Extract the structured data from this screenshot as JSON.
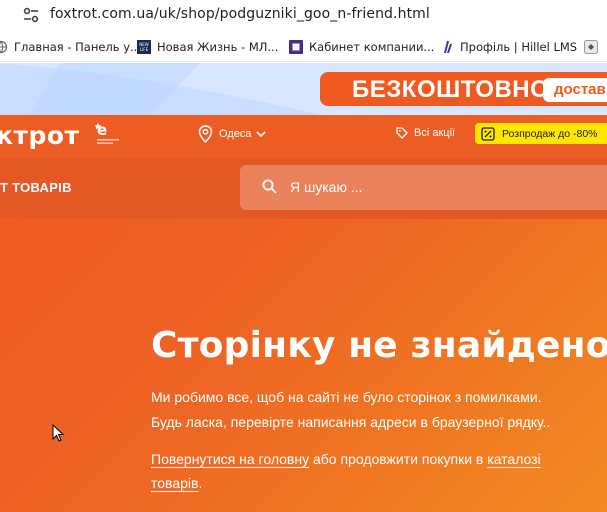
{
  "browser": {
    "url": "foxtrot.com.ua/uk/shop/podguzniki_goo_n-friend.html",
    "bookmarks": [
      {
        "label": "Главная - Панель у...",
        "icon": "globe-icon"
      },
      {
        "label": "Новая Жизнь - МЛ...",
        "icon": "newlife-icon"
      },
      {
        "label": "Кабинет компании...",
        "icon": "purple-square-icon"
      },
      {
        "label": "Профіль | Hillel LMS",
        "icon": "hillel-icon"
      }
    ]
  },
  "promo": {
    "headline": "БЕЗКОШТОВНО",
    "tag": "достав"
  },
  "header": {
    "logo": "ктрот",
    "city": "Одеса",
    "promotions": "Всі акції",
    "sale": "Розпродаж до -80%"
  },
  "subheader": {
    "catalog": "Т ТОВАРІВ",
    "search_placeholder": "Я шукаю ..."
  },
  "error_page": {
    "title": "Сторінку не знайдено",
    "line1": "Ми робимо все, щоб на сайті не було сторінок з помилками.",
    "line2": "Будь ласка, перевірте написання адреси в браузерної рядку..",
    "back_link": "Повернутися на головну",
    "middle_text": " або продовжити покупки в ",
    "catalog_link_part1": "каталозі",
    "catalog_link_part2": "товарів",
    "trailing": "."
  },
  "colors": {
    "brand_orange": "#ed5c22",
    "sale_yellow": "#ffe600"
  }
}
